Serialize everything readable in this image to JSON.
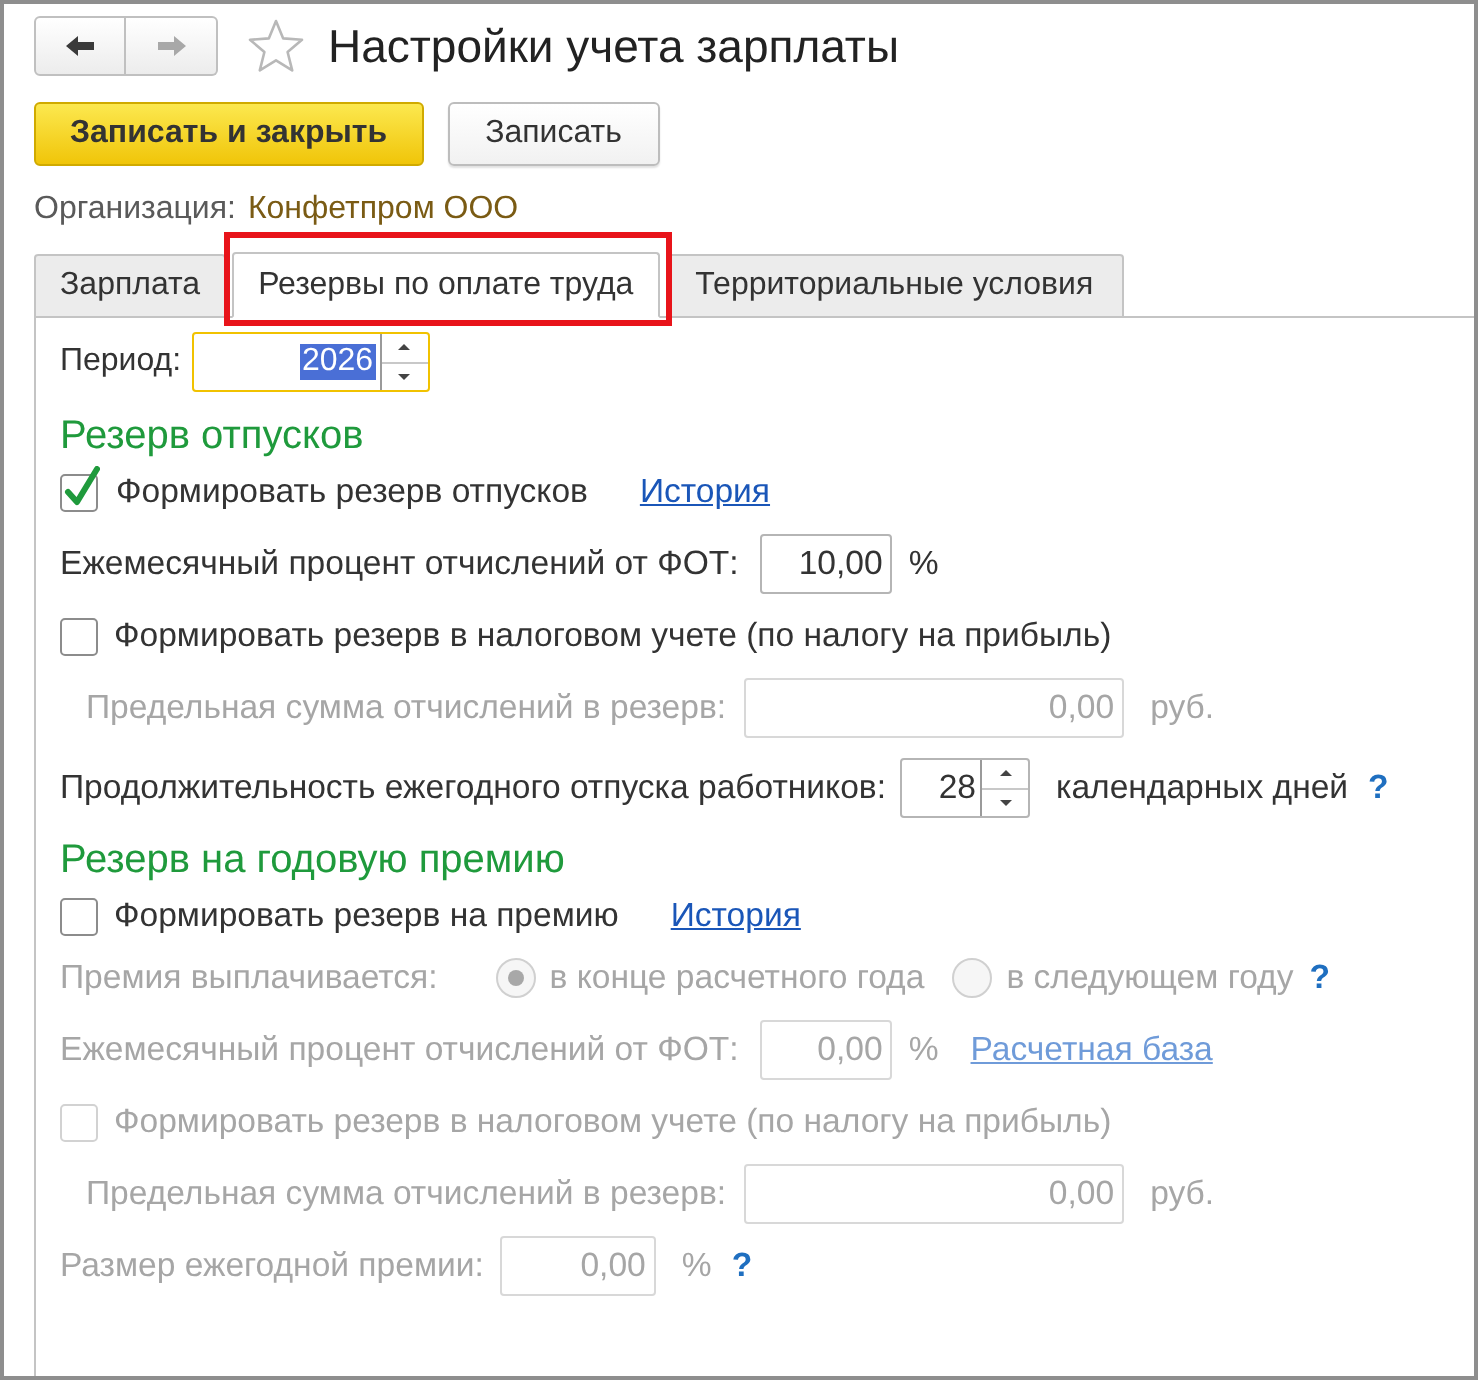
{
  "nav": {
    "back_enabled": true,
    "forward_enabled": false
  },
  "window": {
    "title": "Настройки учета зарплаты",
    "favorite": false
  },
  "toolbar": [
    {
      "label": "Записать и закрыть",
      "kind": "primary"
    },
    {
      "label": "Записать",
      "kind": "default"
    }
  ],
  "organization": {
    "label": "Организация:",
    "value": "Конфетпром ООО"
  },
  "tabs": [
    {
      "label": "Зарплата",
      "selected": false,
      "highlighted": false
    },
    {
      "label": "Резервы по оплате труда",
      "selected": true,
      "highlighted": true
    },
    {
      "label": "Территориальные условия",
      "selected": false,
      "highlighted": false
    }
  ],
  "period": {
    "label": "Период:",
    "value": "2026",
    "focused": true
  },
  "sections": [
    {
      "title": "Резерв отпусков",
      "rows": [
        {
          "kind": "checkbox",
          "label": "Формировать резерв отпусков",
          "checked": true,
          "disabled": false,
          "link": "История"
        },
        {
          "kind": "percent",
          "label": "Ежемесячный процент отчислений от ФОТ:",
          "value": "10,00",
          "unit": "%",
          "disabled": false
        },
        {
          "kind": "checkbox",
          "label": "Формировать резерв в налоговом учете (по налогу на прибыль)",
          "checked": false,
          "disabled": false,
          "children": [
            {
              "kind": "amount",
              "label": "Предельная сумма отчислений в резерв:",
              "value": "0,00",
              "unit": "руб.",
              "disabled": true
            }
          ]
        },
        {
          "kind": "spin",
          "label": "Продолжительность ежегодного отпуска работников:",
          "value": "28",
          "unit": "календарных дней",
          "disabled": false,
          "help": "?"
        }
      ]
    },
    {
      "title": "Резерв на годовую премию",
      "rows": [
        {
          "kind": "checkbox",
          "label": "Формировать резерв на премию",
          "checked": false,
          "disabled": false,
          "link": "История"
        },
        {
          "kind": "radio",
          "label": "Премия выплачивается:",
          "disabled": true,
          "options": [
            {
              "label": "в конце расчетного года",
              "selected": true
            },
            {
              "label": "в следующем году",
              "selected": false
            }
          ],
          "help": "?"
        },
        {
          "kind": "percent",
          "label": "Ежемесячный процент отчислений от ФОТ:",
          "value": "0,00",
          "unit": "%",
          "disabled": true,
          "link": "Расчетная база"
        },
        {
          "kind": "checkbox",
          "label": "Формировать резерв в налоговом учете (по налогу на прибыль)",
          "checked": false,
          "disabled": true,
          "children": [
            {
              "kind": "amount",
              "label": "Предельная сумма отчислений в резерв:",
              "value": "0,00",
              "unit": "руб.",
              "disabled": true
            }
          ]
        },
        {
          "kind": "wide_percent",
          "label": "Размер ежегодной премии:",
          "value": "0,00",
          "unit": "%",
          "disabled": true,
          "help": "?"
        }
      ]
    }
  ]
}
